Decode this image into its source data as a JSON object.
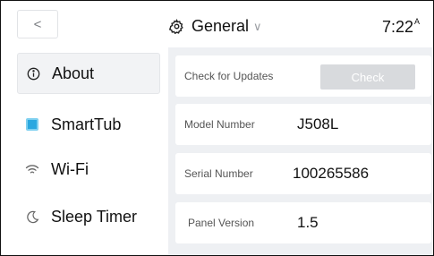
{
  "header": {
    "back_label": "<",
    "title": "General",
    "title_chevron": "∨",
    "time": "7:22",
    "time_suffix": "A",
    "title_icon": "gear-icon"
  },
  "sidebar": {
    "items": [
      {
        "label": "About",
        "icon": "info-icon",
        "active": true
      },
      {
        "label": "SmartTub",
        "icon": "tub-icon"
      },
      {
        "label": "Wi-Fi",
        "icon": "wifi-icon"
      },
      {
        "label": "Sleep Timer",
        "icon": "moon-icon"
      }
    ]
  },
  "settings": {
    "updates_label": "Check for Updates",
    "check_button": "Check",
    "model_label": "Model Number",
    "model_value": "J508L",
    "serial_label": "Serial Number",
    "serial_value": "100265586",
    "panel_label": "Panel Version",
    "panel_value": "1.5"
  },
  "colors": {
    "accent_tub": "#2aa8e0",
    "panel_bg": "#eef0f3",
    "check_button_bg": "#d8dadd"
  }
}
